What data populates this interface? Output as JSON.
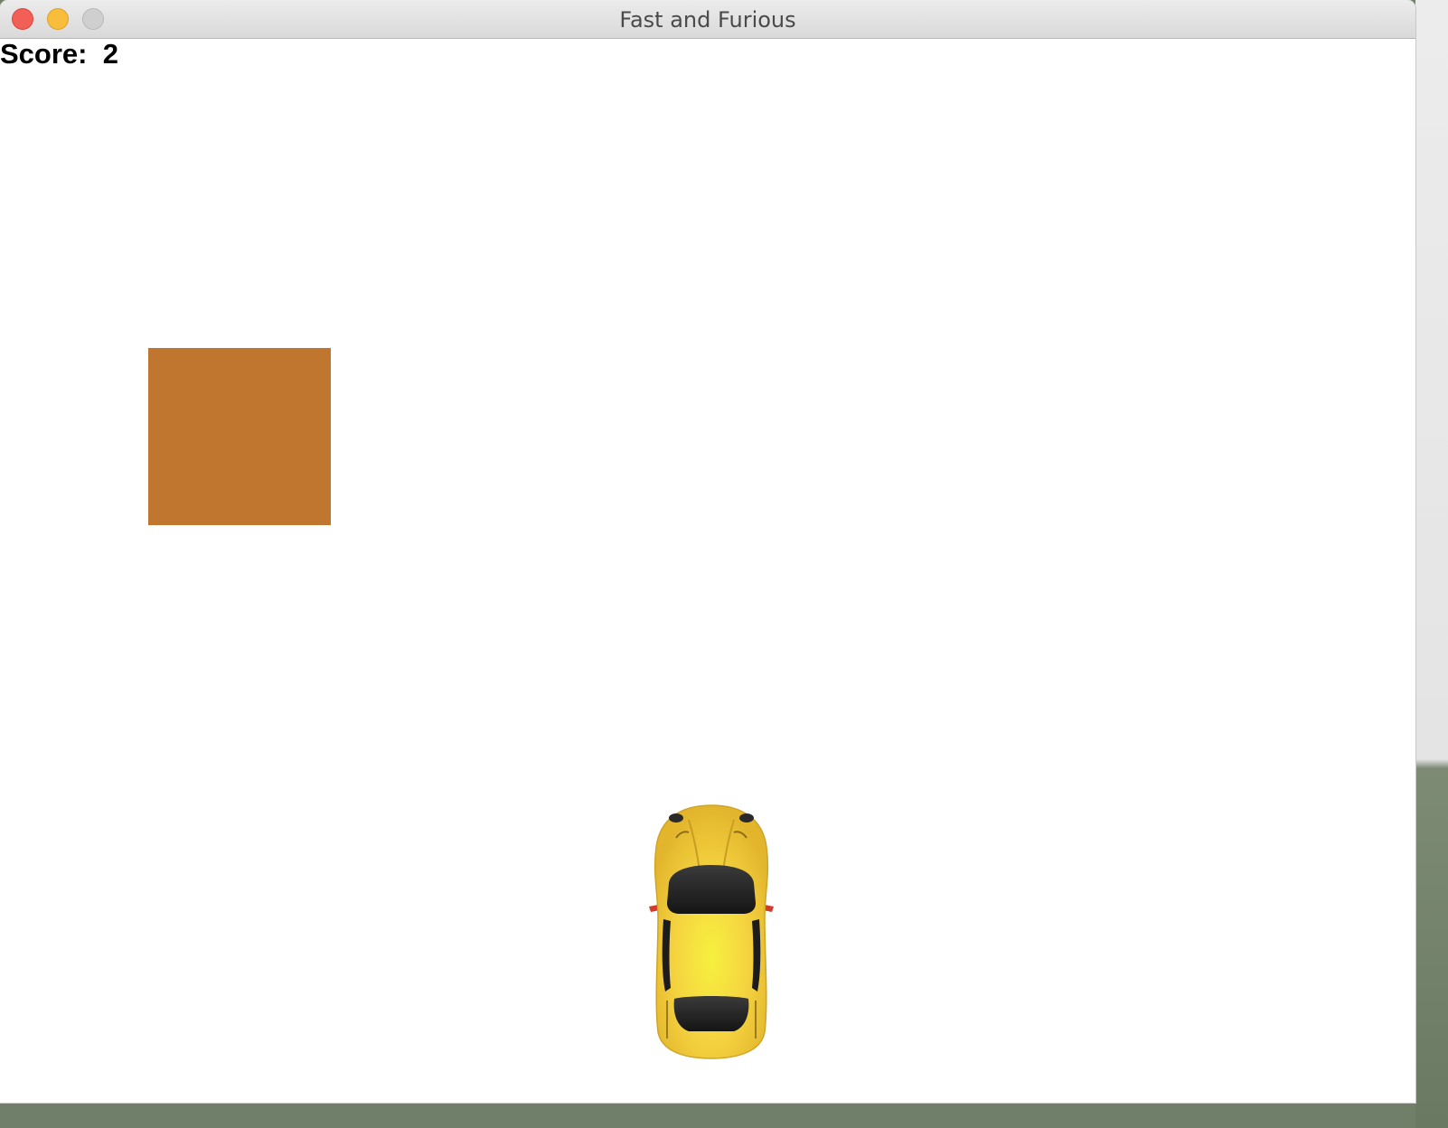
{
  "window": {
    "title": "Fast and Furious",
    "controls": [
      "close",
      "minimize",
      "zoom"
    ]
  },
  "game": {
    "score_label": "Score:",
    "score_value": "2",
    "obstacle": {
      "color": "#c0762e",
      "shape": "square"
    },
    "player": {
      "type": "car",
      "color": "#f5d340",
      "icon": "car-top-view-icon"
    }
  },
  "colors": {
    "background": "#ffffff",
    "text": "#000000"
  }
}
